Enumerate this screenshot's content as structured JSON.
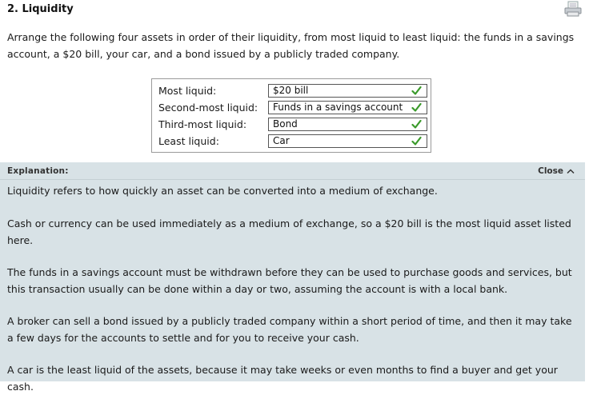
{
  "question": {
    "title": "2. Liquidity",
    "prompt": "Arrange the following four assets in order of their liquidity, from most liquid to least liquid: the funds in a savings account, a $20 bill, your car, and a bond issued by a publicly traded company."
  },
  "answers": [
    {
      "label": "Most liquid:",
      "value": "$20 bill",
      "status": "correct"
    },
    {
      "label": "Second-most liquid:",
      "value": "Funds in a savings account",
      "status": "correct"
    },
    {
      "label": "Third-most liquid:",
      "value": "Bond",
      "status": "correct"
    },
    {
      "label": "Least liquid:",
      "value": "Car",
      "status": "correct"
    }
  ],
  "explanation": {
    "title": "Explanation:",
    "close_label": "Close",
    "paragraphs": [
      "Liquidity refers to how quickly an asset can be converted into a medium of exchange.",
      "Cash or currency can be used immediately as a medium of exchange, so a $20 bill is the most liquid asset listed here.",
      "The funds in a savings account must be withdrawn before they can be used to purchase goods and services, but this transaction usually can be done within a day or two, assuming the account is with a local bank.",
      "A broker can sell a bond issued by a publicly traded company within a short period of time, and then it may take a few days for the accounts to settle and for you to receive your cash.",
      "A car is the least liquid of the assets, because it may take weeks or even months to find a buyer and get your cash."
    ]
  },
  "icons": {
    "print": "print-icon",
    "check": "checkmark-icon",
    "close": "chevron-up-icon"
  },
  "colors": {
    "check_green": "#3a9a2a",
    "explanation_bg": "#d8e2e6"
  }
}
